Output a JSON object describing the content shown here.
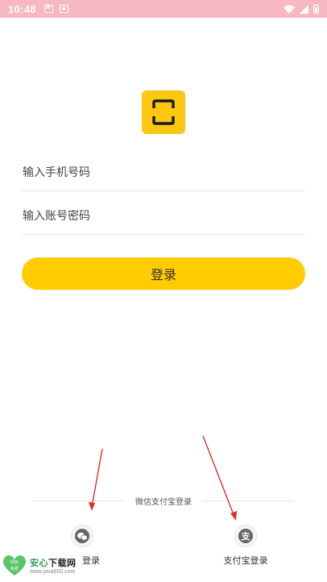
{
  "status_bar": {
    "time": "10:48",
    "icons": [
      "font-notification-icon",
      "card-notification-icon",
      "wifi-icon",
      "signal-icon",
      "battery-icon"
    ]
  },
  "logo": {
    "icon": "scan-frame-icon",
    "color": "#fbc713"
  },
  "form": {
    "phone_placeholder": "输入手机号码",
    "password_placeholder": "输入账号密码",
    "login_label": "登录",
    "accent_color": "#ffcc00"
  },
  "third_party": {
    "divider_label": "微信支付宝登录",
    "wechat_label": "登录",
    "alipay_label": "支付宝登录",
    "alipay_glyph": "支"
  },
  "watermark": {
    "badge_top": "绿色",
    "badge_bottom": "免费",
    "title_green": "安心",
    "title_dark": "下载网",
    "url": "www.java800.com"
  }
}
